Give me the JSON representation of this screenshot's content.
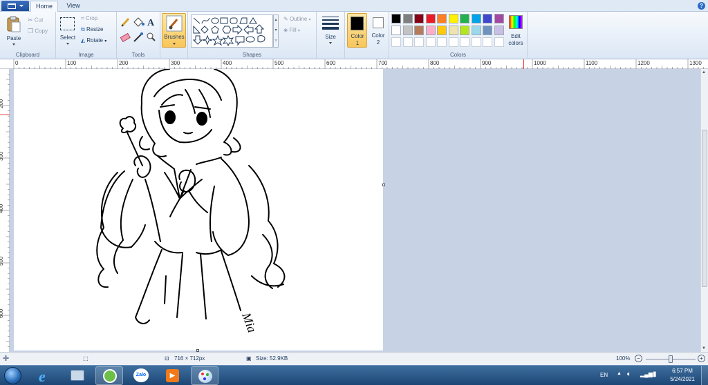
{
  "tabs": {
    "home": "Home",
    "view": "View"
  },
  "help_label": "?",
  "ribbon": {
    "clipboard": {
      "label": "Clipboard",
      "paste": "Paste",
      "cut": "Cut",
      "copy": "Copy"
    },
    "image": {
      "label": "Image",
      "select": "Select",
      "crop": "Crop",
      "resize": "Resize",
      "rotate": "Rotate"
    },
    "tools": {
      "label": "Tools"
    },
    "brushes": {
      "label": "Brushes"
    },
    "shapes": {
      "label": "Shapes",
      "outline": "Outline",
      "fill": "Fill"
    },
    "size": {
      "label": "Size"
    },
    "color1": {
      "label": "Color",
      "num": "1",
      "value": "#000000"
    },
    "color2": {
      "label": "Color",
      "num": "2",
      "value": "#ffffff"
    },
    "colors": {
      "label": "Colors",
      "edit_label": "Edit",
      "edit_label2": "colors",
      "row1": [
        "#000000",
        "#7f7f7f",
        "#880015",
        "#ed1c24",
        "#ff7f27",
        "#fff200",
        "#22b14c",
        "#00a2e8",
        "#3f48cc",
        "#a349a4"
      ],
      "row2": [
        "#ffffff",
        "#c3c3c3",
        "#b97a57",
        "#ffaec9",
        "#ffc90e",
        "#efe4b0",
        "#b5e61d",
        "#99d9ea",
        "#7092be",
        "#c8bfe7"
      ]
    }
  },
  "ruler": {
    "h": [
      "0",
      "100",
      "200",
      "300",
      "400",
      "500",
      "600",
      "700",
      "800",
      "900",
      "1000",
      "1100",
      "1200",
      "1300"
    ],
    "v": [
      "200",
      "300",
      "400",
      "500",
      "600"
    ]
  },
  "status": {
    "dimensions": "716 × 712px",
    "size": "Size: 52.9KB",
    "zoom": "100%",
    "zoom_level": 1.0
  },
  "taskbar": {
    "lang": "EN",
    "time": "6:57 PM",
    "date": "5/24/2021",
    "zalo_label": "Zalo"
  },
  "drawing": {
    "signature": "Mia"
  }
}
